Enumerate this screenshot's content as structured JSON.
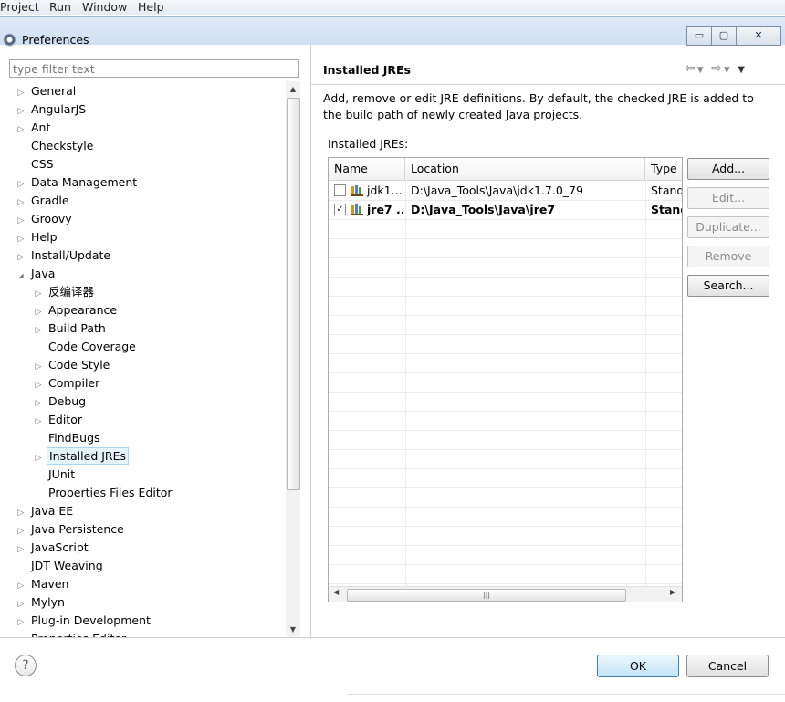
{
  "ide_menu": [
    "Project",
    "Run",
    "Window",
    "Help"
  ],
  "window": {
    "title": "Preferences",
    "controls": {
      "minimize": "▭",
      "maximize": "▢",
      "close": "✕"
    }
  },
  "filter": {
    "placeholder": "type filter text"
  },
  "tree": [
    {
      "label": "General",
      "level": 0,
      "toggle": "collapsed"
    },
    {
      "label": "AngularJS",
      "level": 0,
      "toggle": "collapsed"
    },
    {
      "label": "Ant",
      "level": 0,
      "toggle": "collapsed"
    },
    {
      "label": "Checkstyle",
      "level": 0,
      "toggle": "none"
    },
    {
      "label": "CSS",
      "level": 0,
      "toggle": "none"
    },
    {
      "label": "Data Management",
      "level": 0,
      "toggle": "collapsed"
    },
    {
      "label": "Gradle",
      "level": 0,
      "toggle": "collapsed"
    },
    {
      "label": "Groovy",
      "level": 0,
      "toggle": "collapsed"
    },
    {
      "label": "Help",
      "level": 0,
      "toggle": "collapsed"
    },
    {
      "label": "Install/Update",
      "level": 0,
      "toggle": "collapsed"
    },
    {
      "label": "Java",
      "level": 0,
      "toggle": "expanded"
    },
    {
      "label": "反编译器",
      "level": 1,
      "toggle": "collapsed"
    },
    {
      "label": "Appearance",
      "level": 1,
      "toggle": "collapsed"
    },
    {
      "label": "Build Path",
      "level": 1,
      "toggle": "collapsed"
    },
    {
      "label": "Code Coverage",
      "level": 1,
      "toggle": "none"
    },
    {
      "label": "Code Style",
      "level": 1,
      "toggle": "collapsed"
    },
    {
      "label": "Compiler",
      "level": 1,
      "toggle": "collapsed"
    },
    {
      "label": "Debug",
      "level": 1,
      "toggle": "collapsed"
    },
    {
      "label": "Editor",
      "level": 1,
      "toggle": "collapsed"
    },
    {
      "label": "FindBugs",
      "level": 1,
      "toggle": "none"
    },
    {
      "label": "Installed JREs",
      "level": 1,
      "toggle": "collapsed",
      "selected": true
    },
    {
      "label": "JUnit",
      "level": 1,
      "toggle": "none"
    },
    {
      "label": "Properties Files Editor",
      "level": 1,
      "toggle": "none"
    },
    {
      "label": "Java EE",
      "level": 0,
      "toggle": "collapsed"
    },
    {
      "label": "Java Persistence",
      "level": 0,
      "toggle": "collapsed"
    },
    {
      "label": "JavaScript",
      "level": 0,
      "toggle": "collapsed"
    },
    {
      "label": "JDT Weaving",
      "level": 0,
      "toggle": "none"
    },
    {
      "label": "Maven",
      "level": 0,
      "toggle": "collapsed"
    },
    {
      "label": "Mylyn",
      "level": 0,
      "toggle": "collapsed"
    },
    {
      "label": "Plug-in Development",
      "level": 0,
      "toggle": "collapsed"
    },
    {
      "label": "Properties Editor",
      "level": 0,
      "toggle": "collapsed"
    }
  ],
  "page": {
    "title": "Installed JREs",
    "description": "Add, remove or edit JRE definitions. By default, the checked JRE is added to the build path of newly created Java projects.",
    "list_label": "Installed JREs:",
    "columns": [
      "Name",
      "Location",
      "Type"
    ],
    "rows": [
      {
        "checked": false,
        "name": "jdk1....",
        "location": "D:\\Java_Tools\\Java\\jdk1.7.0_79",
        "type": "Stand",
        "bold": false
      },
      {
        "checked": true,
        "name": "jre7 ...",
        "location": "D:\\Java_Tools\\Java\\jre7",
        "type": "Stand",
        "bold": true
      }
    ],
    "buttons": [
      {
        "label": "Add...",
        "enabled": true
      },
      {
        "label": "Edit...",
        "enabled": false
      },
      {
        "label": "Duplicate...",
        "enabled": false
      },
      {
        "label": "Remove",
        "enabled": false
      },
      {
        "label": "Search...",
        "enabled": true
      }
    ],
    "hscroll_grip": "|||"
  },
  "footer": {
    "help_icon": "?",
    "ok_label": "OK",
    "cancel_label": "Cancel"
  }
}
